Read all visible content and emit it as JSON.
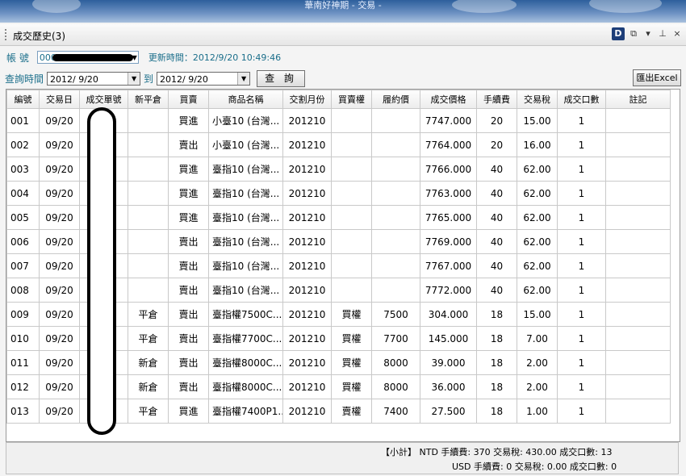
{
  "window": {
    "title": "華南好神期 - 交易 -"
  },
  "panel": {
    "title": "成交歷史(3)",
    "d_label": "D"
  },
  "account": {
    "label": "帳 號",
    "value": "000-",
    "updated": "更新時間：2012/9/20 10:49:46"
  },
  "query": {
    "label": "查詢時間",
    "from": "2012/ 9/20",
    "to_label": "到",
    "to": "2012/ 9/20",
    "button": "查 詢",
    "export": "匯出Excel"
  },
  "table": {
    "headers": [
      "編號",
      "交易日",
      "成交單號",
      "新平倉",
      "買賣",
      "商品名稱",
      "交割月份",
      "買賣權",
      "履約價",
      "成交價格",
      "手續費",
      "交易稅",
      "成交口數",
      "註記"
    ],
    "rows": [
      [
        "001",
        "09/20",
        "",
        "",
        "買進",
        "小臺10 (台灣...",
        "201210",
        "",
        "",
        "7747.000",
        "20",
        "15.00",
        "1",
        ""
      ],
      [
        "002",
        "09/20",
        "",
        "",
        "賣出",
        "小臺10 (台灣...",
        "201210",
        "",
        "",
        "7764.000",
        "20",
        "16.00",
        "1",
        ""
      ],
      [
        "003",
        "09/20",
        "",
        "",
        "買進",
        "臺指10 (台灣...",
        "201210",
        "",
        "",
        "7766.000",
        "40",
        "62.00",
        "1",
        ""
      ],
      [
        "004",
        "09/20",
        "",
        "",
        "買進",
        "臺指10 (台灣...",
        "201210",
        "",
        "",
        "7763.000",
        "40",
        "62.00",
        "1",
        ""
      ],
      [
        "005",
        "09/20",
        "",
        "",
        "買進",
        "臺指10 (台灣...",
        "201210",
        "",
        "",
        "7765.000",
        "40",
        "62.00",
        "1",
        ""
      ],
      [
        "006",
        "09/20",
        "",
        "",
        "賣出",
        "臺指10 (台灣...",
        "201210",
        "",
        "",
        "7769.000",
        "40",
        "62.00",
        "1",
        ""
      ],
      [
        "007",
        "09/20",
        "",
        "",
        "賣出",
        "臺指10 (台灣...",
        "201210",
        "",
        "",
        "7767.000",
        "40",
        "62.00",
        "1",
        ""
      ],
      [
        "008",
        "09/20",
        "",
        "",
        "賣出",
        "臺指10 (台灣...",
        "201210",
        "",
        "",
        "7772.000",
        "40",
        "62.00",
        "1",
        ""
      ],
      [
        "009",
        "09/20",
        "",
        "平倉",
        "賣出",
        "臺指權7500C...",
        "201210",
        "買權",
        "7500",
        "304.000",
        "18",
        "15.00",
        "1",
        ""
      ],
      [
        "010",
        "09/20",
        "",
        "平倉",
        "賣出",
        "臺指權7700C...",
        "201210",
        "買權",
        "7700",
        "145.000",
        "18",
        "7.00",
        "1",
        ""
      ],
      [
        "011",
        "09/20",
        "",
        "新倉",
        "賣出",
        "臺指權8000C...",
        "201210",
        "買權",
        "8000",
        "39.000",
        "18",
        "2.00",
        "1",
        ""
      ],
      [
        "012",
        "09/20",
        "",
        "新倉",
        "賣出",
        "臺指權8000C...",
        "201210",
        "買權",
        "8000",
        "36.000",
        "18",
        "2.00",
        "1",
        ""
      ],
      [
        "013",
        "09/20",
        "",
        "平倉",
        "買進",
        "臺指權7400P1...",
        "201210",
        "賣權",
        "7400",
        "27.500",
        "18",
        "1.00",
        "1",
        ""
      ]
    ]
  },
  "summary": {
    "line1": "【小計】   NTD 手續費: 370    交易稅: 430.00    成交口數: 13",
    "line2": "USD 手續費: 0    交易稅: 0.00    成交口數: 0"
  }
}
